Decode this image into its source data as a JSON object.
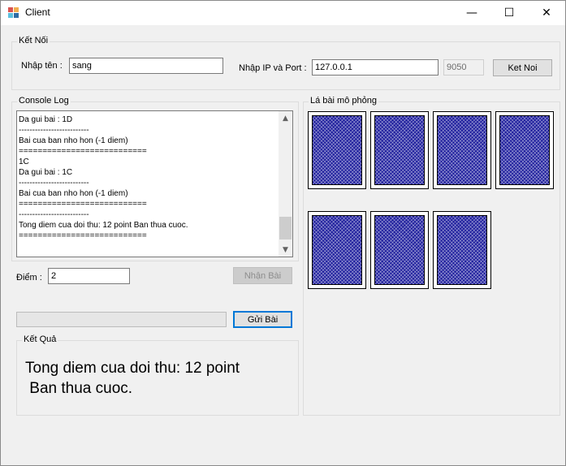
{
  "window": {
    "title": "Client",
    "controls": {
      "minimize": "—",
      "maximize": "☐",
      "close": "✕"
    }
  },
  "connection": {
    "group_label": "Kết Nối",
    "name_label": "Nhập tên :",
    "name_value": "sang",
    "ipport_label": "Nhập IP và Port :",
    "ip_value": "127.0.0.1",
    "port_value": "9050",
    "connect_button": "Ket Noi"
  },
  "console": {
    "group_label": "Console Log",
    "text": "Da gui bai : 1D\n--------------------------\nBai cua ban nho hon (-1 diem)\n===========================\n1C\nDa gui bai : 1C\n--------------------------\nBai cua ban nho hon (-1 diem)\n===========================\n--------------------------\nTong diem cua doi thu: 12 point Ban thua cuoc.\n==========================="
  },
  "score": {
    "label": "Điểm :",
    "value": "2",
    "draw_button": "Nhận Bài"
  },
  "send": {
    "input_value": "",
    "button": "Gửi Bài"
  },
  "result": {
    "group_label": "Kết Quả",
    "text": "Tong diem cua doi thu: 12 point\n Ban thua cuoc."
  },
  "cards": {
    "group_label": "Lá bài mô phỏng",
    "count": 7,
    "back_color": "#1c1c9c"
  },
  "colors": {
    "focus": "#0078d7",
    "window_bg": "#f0f0f0"
  }
}
